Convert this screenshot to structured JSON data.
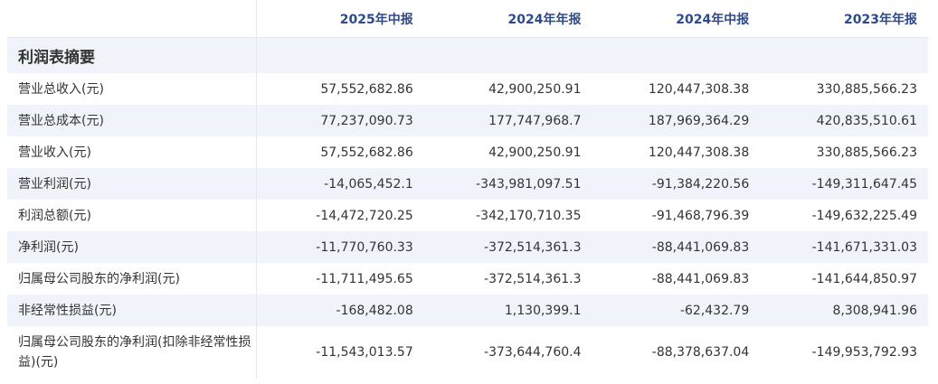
{
  "table": {
    "headers": [
      "",
      "2025年中报",
      "2024年年报",
      "2024年中报",
      "2023年年报"
    ],
    "section_title": "利润表摘要",
    "rows": [
      {
        "label": "营业总收入(元)",
        "values": [
          "57,552,682.86",
          "42,900,250.91",
          "120,447,308.38",
          "330,885,566.23"
        ]
      },
      {
        "label": "营业总成本(元)",
        "values": [
          "77,237,090.73",
          "177,747,968.7",
          "187,969,364.29",
          "420,835,510.61"
        ]
      },
      {
        "label": "营业收入(元)",
        "values": [
          "57,552,682.86",
          "42,900,250.91",
          "120,447,308.38",
          "330,885,566.23"
        ]
      },
      {
        "label": "营业利润(元)",
        "values": [
          "-14,065,452.1",
          "-343,981,097.51",
          "-91,384,220.56",
          "-149,311,647.45"
        ]
      },
      {
        "label": "利润总额(元)",
        "values": [
          "-14,472,720.25",
          "-342,170,710.35",
          "-91,468,796.39",
          "-149,632,225.49"
        ]
      },
      {
        "label": "净利润(元)",
        "values": [
          "-11,770,760.33",
          "-372,514,361.3",
          "-88,441,069.83",
          "-141,671,331.03"
        ]
      },
      {
        "label": "归属母公司股东的净利润(元)",
        "values": [
          "-11,711,495.65",
          "-372,514,361.3",
          "-88,441,069.83",
          "-141,644,850.97"
        ]
      },
      {
        "label": "非经常性损益(元)",
        "values": [
          "-168,482.08",
          "1,130,399.1",
          "-62,432.79",
          "8,308,941.96"
        ]
      },
      {
        "label": "归属母公司股东的净利润(扣除非经常性损益)(元)",
        "values": [
          "-11,543,013.57",
          "-373,644,760.4",
          "-88,378,637.04",
          "-149,953,792.93"
        ]
      }
    ]
  }
}
